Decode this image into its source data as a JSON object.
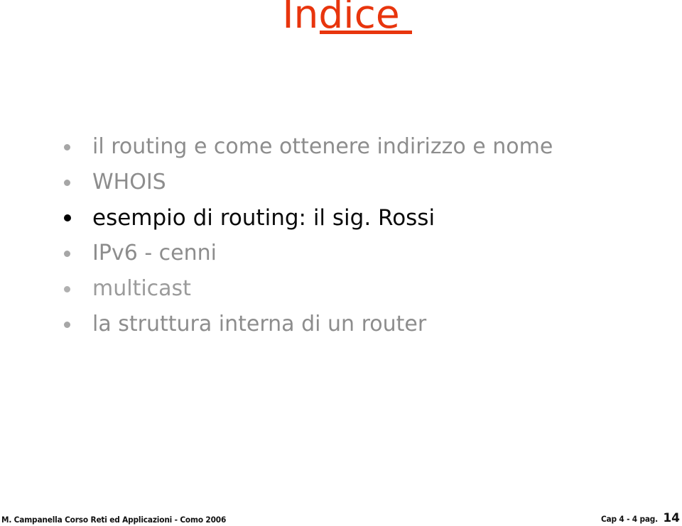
{
  "slide": {
    "title": "Indice",
    "title_color": "#e8350d",
    "background_color": "#ffffff",
    "bullets": [
      {
        "text": "il routing e come ottenere indirizzo e nome",
        "color": "#8d8d8d",
        "style": "normal"
      },
      {
        "text": "WHOIS",
        "color": "#8d8d8d",
        "style": "normal"
      },
      {
        "text": "esempio di routing: il sig. Rossi",
        "color": "#0a0a0a",
        "style": "emphasis"
      },
      {
        "text": "IPv6 - cenni",
        "color": "#8d8d8d",
        "style": "normal"
      },
      {
        "text": "multicast",
        "color": "#9b9b9b",
        "style": "light"
      },
      {
        "text": "la struttura interna di un router",
        "color": "#8d8d8d",
        "style": "normal"
      }
    ],
    "footer": {
      "attribution": "M. Campanella Corso Reti ed Applicazioni - Como 2006",
      "chapter": "Cap 4 - 4 pag.",
      "page_number": "14"
    }
  }
}
